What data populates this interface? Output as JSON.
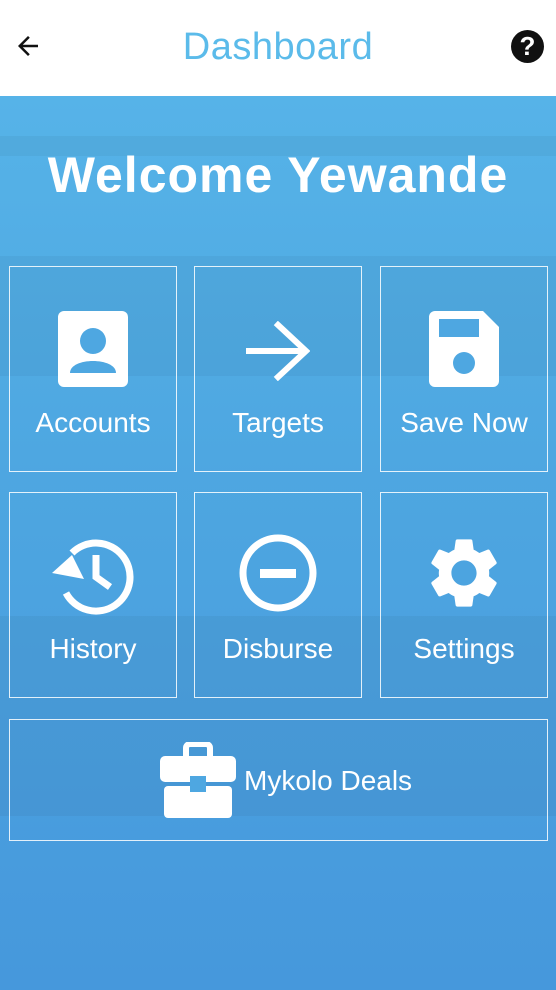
{
  "header": {
    "title": "Dashboard",
    "back_icon": "arrow-left-icon",
    "help_label": "?"
  },
  "welcome": "Welcome Yewande",
  "tiles": [
    {
      "label": "Accounts",
      "icon": "account-box-icon"
    },
    {
      "label": "Targets",
      "icon": "arrow-right-icon"
    },
    {
      "label": "Save Now",
      "icon": "floppy-disk-icon"
    },
    {
      "label": "History",
      "icon": "history-icon"
    },
    {
      "label": "Disburse",
      "icon": "minus-circle-icon"
    },
    {
      "label": "Settings",
      "icon": "gear-icon"
    }
  ],
  "deals": {
    "label": "Mykolo Deals",
    "icon": "briefcase-icon"
  },
  "colors": {
    "accent": "#5bbbea",
    "background": "#4ea7e1",
    "foreground": "#ffffff"
  }
}
